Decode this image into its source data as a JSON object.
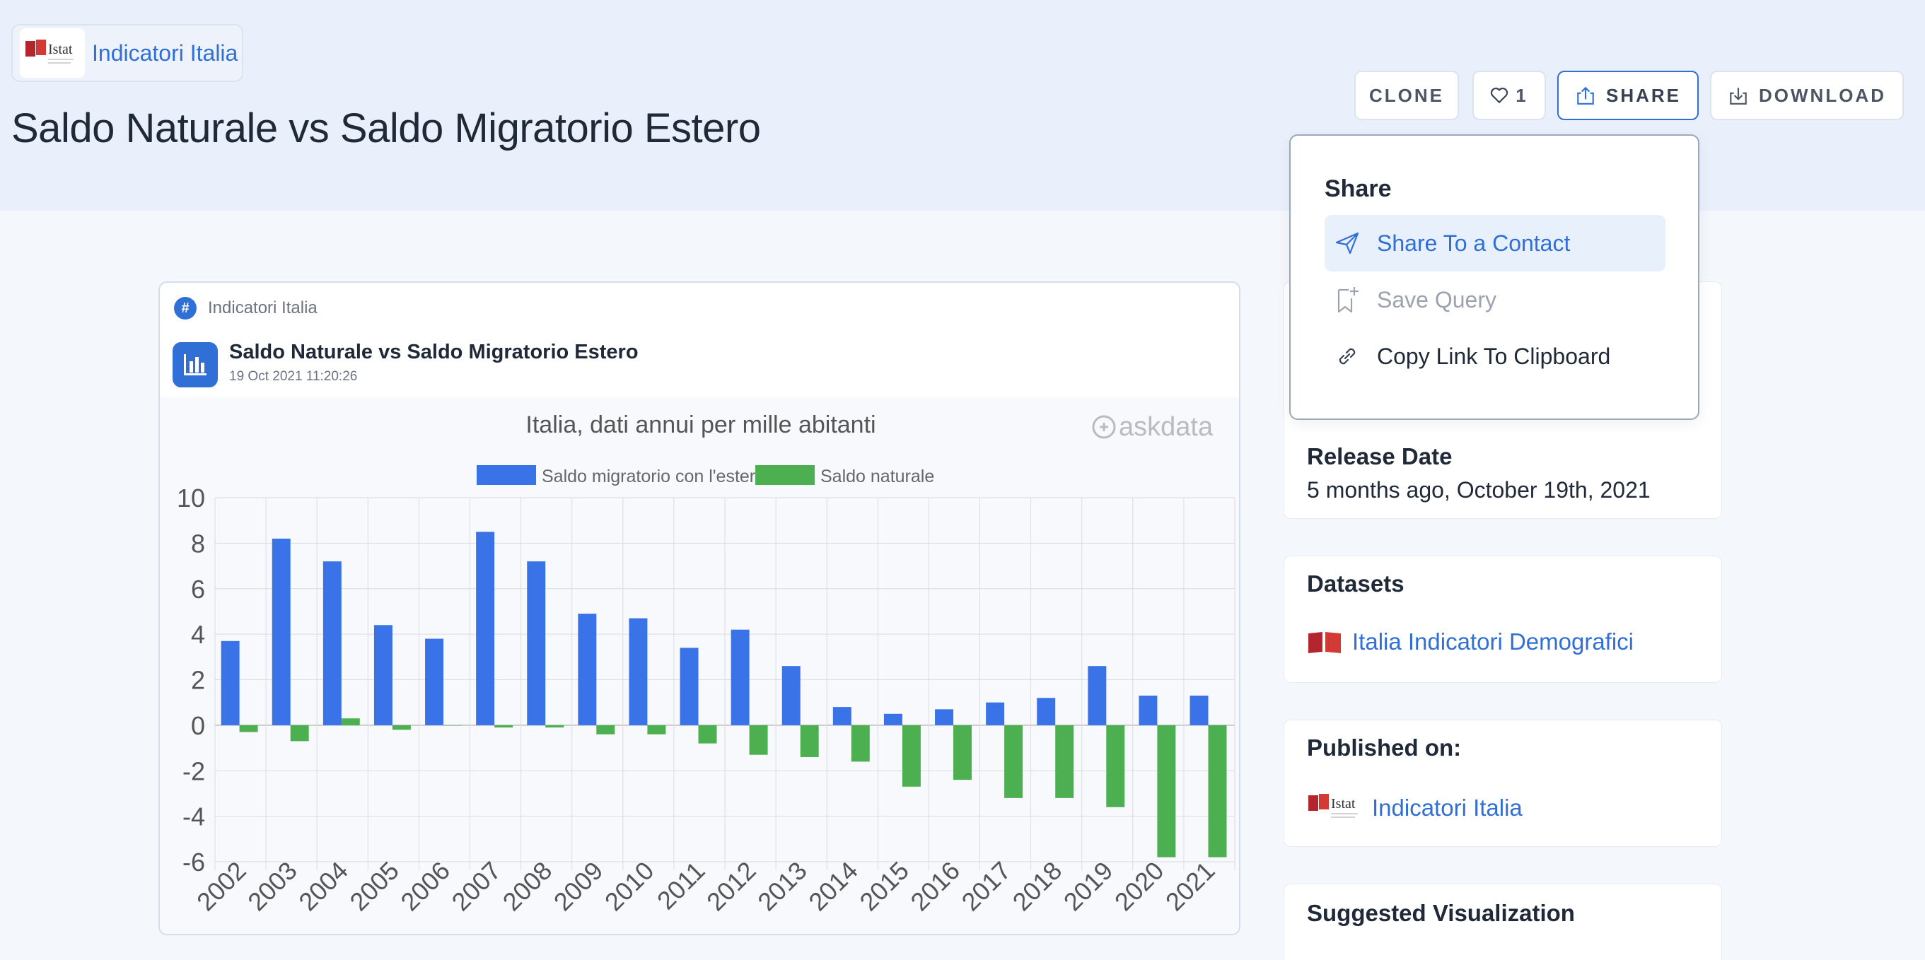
{
  "brand": {
    "name": "Indicatori Italia",
    "logo_text": "Istat"
  },
  "page": {
    "title": "Saldo Naturale vs Saldo Migratorio Estero"
  },
  "toolbar": {
    "clone_label": "CLONE",
    "like_count": "1",
    "share_label": "SHARE",
    "download_label": "DOWNLOAD"
  },
  "share_menu": {
    "title": "Share",
    "items": [
      {
        "label": "Share To a Contact",
        "icon": "send-icon",
        "state": "selected"
      },
      {
        "label": "Save Query",
        "icon": "bookmark-plus-icon",
        "state": "disabled"
      },
      {
        "label": "Copy Link To Clipboard",
        "icon": "link-icon",
        "state": "normal"
      }
    ]
  },
  "card": {
    "tag": "Indicatori Italia",
    "title": "Saldo Naturale vs Saldo Migratorio Estero",
    "date": "19 Oct 2021 11:20:26"
  },
  "chart_data": {
    "type": "bar",
    "title": "Italia, dati annui per mille abitanti",
    "watermark": "askdata",
    "legend_position": "top",
    "grid": true,
    "ylim": [
      -6,
      10
    ],
    "yticks": [
      10,
      8,
      6,
      4,
      2,
      0,
      -2,
      -4,
      -6
    ],
    "categories": [
      "2002",
      "2003",
      "2004",
      "2005",
      "2006",
      "2007",
      "2008",
      "2009",
      "2010",
      "2011",
      "2012",
      "2013",
      "2014",
      "2015",
      "2016",
      "2017",
      "2018",
      "2019",
      "2020",
      "2021"
    ],
    "series": [
      {
        "name": "Saldo migratorio con l'estero",
        "color": "#3a72e8",
        "values": [
          3.7,
          8.2,
          7.2,
          4.4,
          3.8,
          8.5,
          7.2,
          4.9,
          4.7,
          3.4,
          4.2,
          2.6,
          0.8,
          0.5,
          0.7,
          1.0,
          1.2,
          2.6,
          1.3,
          1.3
        ]
      },
      {
        "name": "Saldo naturale",
        "color": "#4caf50",
        "values": [
          -0.3,
          -0.7,
          0.3,
          -0.2,
          0.0,
          -0.1,
          -0.1,
          -0.4,
          -0.4,
          -0.8,
          -1.3,
          -1.4,
          -1.6,
          -2.7,
          -2.4,
          -3.2,
          -3.2,
          -3.6,
          -5.8,
          -5.8
        ]
      }
    ]
  },
  "sidebar": {
    "release_date_label": "Release Date",
    "release_date_value": "5 months ago, October 19th, 2021",
    "datasets_label": "Datasets",
    "dataset_name": "Italia Indicatori Demografici",
    "published_label": "Published on:",
    "published_name": "Indicatori Italia",
    "suggested_label": "Suggested Visualization"
  }
}
